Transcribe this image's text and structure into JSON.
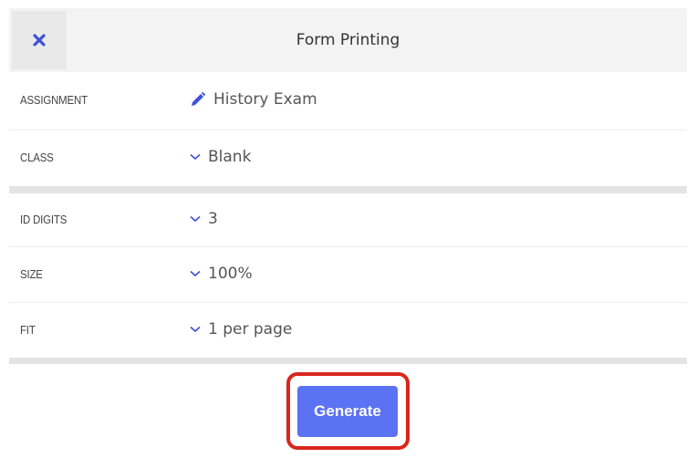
{
  "header": {
    "title": "Form Printing",
    "close_icon": "close-icon",
    "accent": "#3f51d8"
  },
  "rows": [
    {
      "label": "ASSIGNMENT",
      "value": "History Exam",
      "icon": "pencil-icon"
    },
    {
      "label": "CLASS",
      "value": "Blank",
      "icon": "chevron-down-icon"
    },
    {
      "label": "ID DIGITS",
      "value": "3",
      "icon": "chevron-down-icon"
    },
    {
      "label": "SIZE",
      "value": "100%",
      "icon": "chevron-down-icon"
    },
    {
      "label": "FIT",
      "value": "1 per page",
      "icon": "chevron-down-icon"
    }
  ],
  "actions": {
    "generate_label": "Generate",
    "button_color": "#5b72f2",
    "highlight_color": "#d9261c"
  }
}
